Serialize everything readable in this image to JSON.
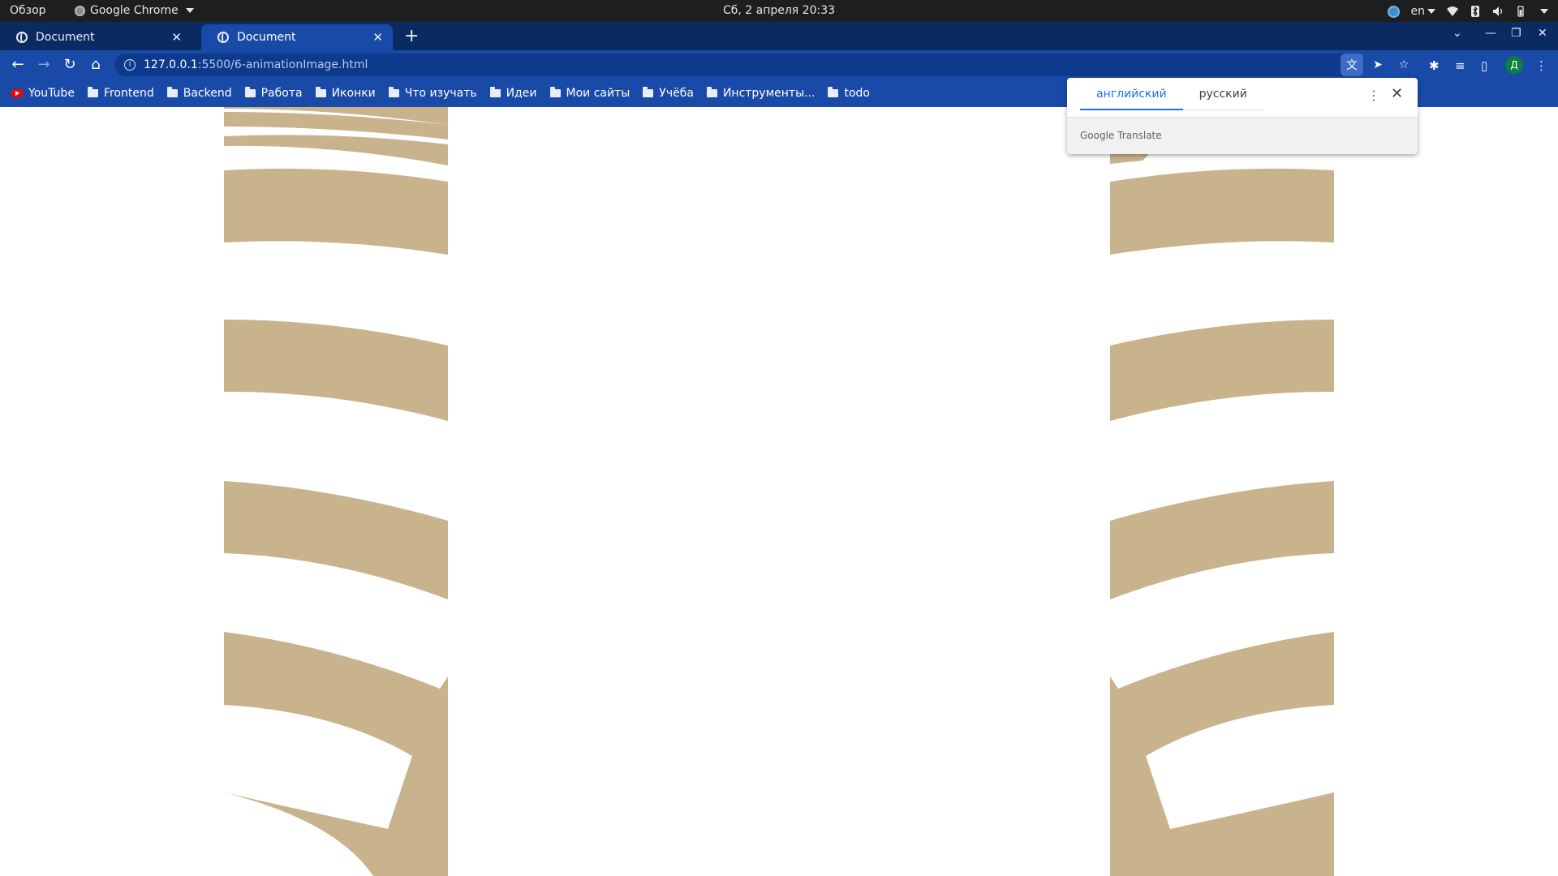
{
  "topbar": {
    "overview": "Обзор",
    "app_name": "Google Chrome",
    "datetime": "Сб, 2 апреля  20:33",
    "lang": "en"
  },
  "tabs": [
    {
      "title": "Document"
    },
    {
      "title": "Document"
    }
  ],
  "toolbar": {
    "url_host": "127.0.0.1",
    "url_path": ":5500/6-animationImage.html",
    "profile_initial": "Д"
  },
  "bookmarks": [
    {
      "label": "YouTube",
      "icon": "youtube-icon"
    },
    {
      "label": "Frontend",
      "icon": "folder-icon"
    },
    {
      "label": "Backend",
      "icon": "folder-icon"
    },
    {
      "label": "Работа",
      "icon": "folder-icon"
    },
    {
      "label": "Иконки",
      "icon": "folder-icon"
    },
    {
      "label": "Что изучать",
      "icon": "folder-icon"
    },
    {
      "label": "Идеи",
      "icon": "folder-icon"
    },
    {
      "label": "Мои сайты",
      "icon": "folder-icon"
    },
    {
      "label": "Учёба",
      "icon": "folder-icon"
    },
    {
      "label": "Инструменты...",
      "icon": "folder-icon"
    },
    {
      "label": "todo",
      "icon": "folder-icon"
    }
  ],
  "translate_popup": {
    "source_lang": "английский",
    "target_lang": "русский",
    "brand": "Google",
    "product": "Translate"
  },
  "colors": {
    "page_shape": "#c9b38d",
    "chrome_accent": "#1a4aa8"
  }
}
